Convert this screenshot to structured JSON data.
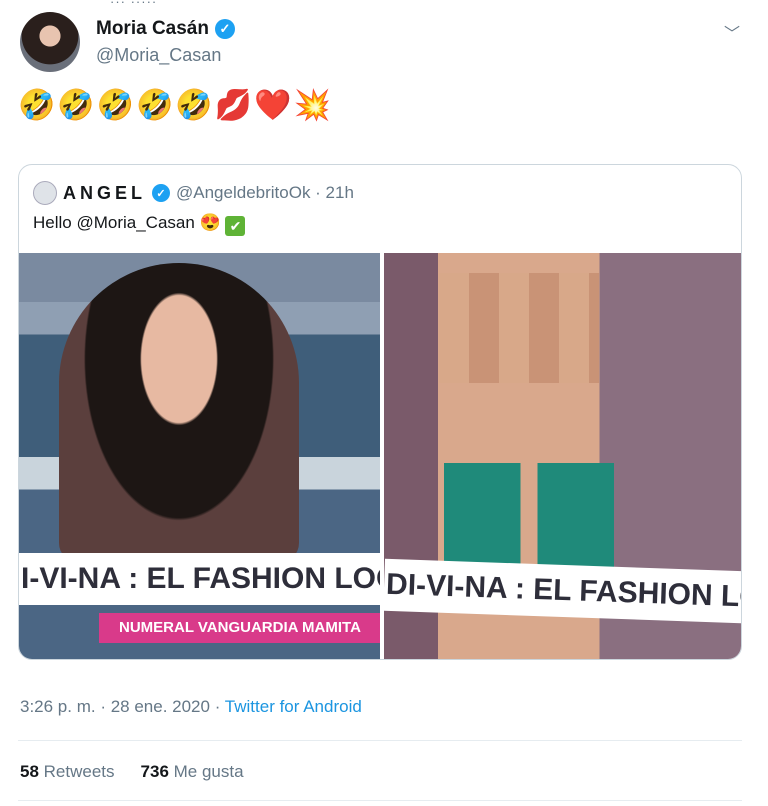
{
  "top_cut_text": "··· ·····",
  "tweet": {
    "name": "Moria Casán",
    "handle": "@Moria_Casan",
    "emojis": "🤣🤣🤣🤣🤣💋❤️💥",
    "timestamp": "3:26 p. m. · 28 ene. 2020",
    "source_separator": "·",
    "source": "Twitter for Android",
    "retweets_count": "58",
    "retweets_label": "Retweets",
    "likes_count": "736",
    "likes_label": "Me gusta"
  },
  "quoted": {
    "name": "ANGEL",
    "handle": "@AngeldebritoOk · 21h",
    "text": "Hello @Moria_Casan 😍",
    "check": "✔",
    "images": [
      {
        "banner": "I-VI-NA : EL FASHION LOOK D",
        "subbar": "NUMERAL VANGUARDIA MAMITA"
      },
      {
        "banner": "DI-VI-NA : EL FASHION LOOK"
      }
    ]
  },
  "colors": {
    "link": "#1b95e0",
    "verified": "#1da1f2",
    "muted": "#657786"
  }
}
